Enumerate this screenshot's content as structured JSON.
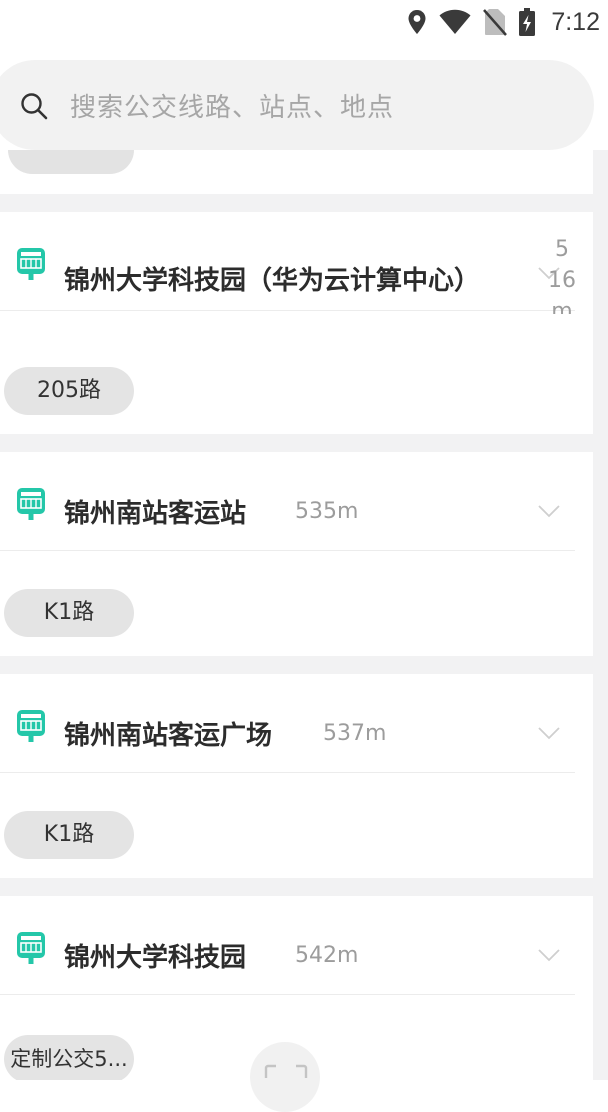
{
  "status_bar": {
    "time": "7:12",
    "icons": [
      "location-icon",
      "wifi-icon",
      "no-sim-icon",
      "battery-charging-icon"
    ]
  },
  "search": {
    "placeholder": "搜索公交线路、站点、地点",
    "icon": "search-icon"
  },
  "stations": [
    {
      "name": "锦州大学科技园（华为云计算中心）",
      "distance_lines": [
        "5",
        "16",
        "m"
      ],
      "routes": [
        "205路"
      ]
    },
    {
      "name": "锦州南站客运站",
      "distance": "535m",
      "routes": [
        "K1路"
      ]
    },
    {
      "name": "锦州南站客运广场",
      "distance": "537m",
      "routes": [
        "K1路"
      ]
    },
    {
      "name": "锦州大学科技园",
      "distance": "542m",
      "routes": [
        "定制公交5..."
      ]
    }
  ],
  "colors": {
    "accent": "#24c7a9",
    "page_bg": "#f2f2f3",
    "chip_bg": "#e4e4e4",
    "muted_text": "#9c9c9c"
  }
}
